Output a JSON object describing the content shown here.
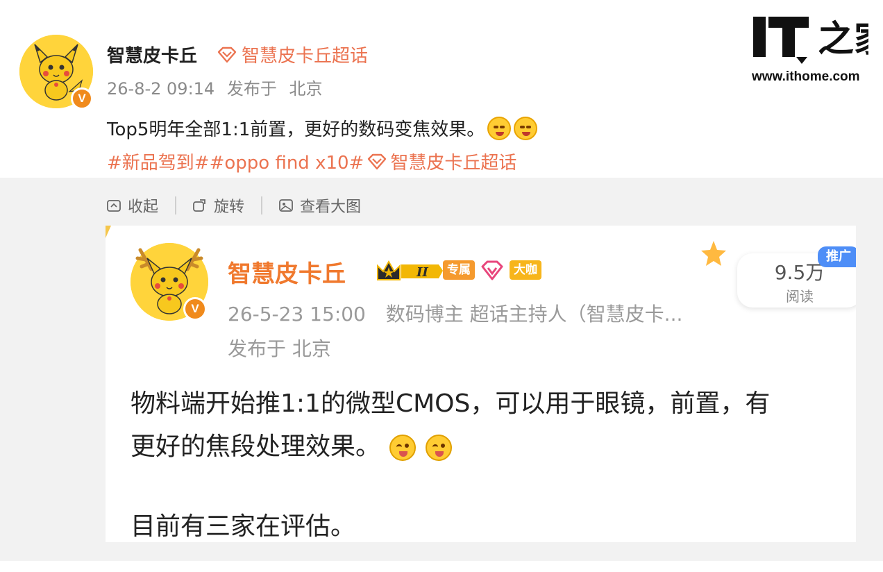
{
  "post": {
    "username": "智慧皮卡丘",
    "supertopic": "智慧皮卡丘超话",
    "time": "26-8-2 09:14",
    "location_prefix": "发布于",
    "location": "北京",
    "text": "Top5明年全部1:1前置，更好的数码变焦效果。",
    "tags_prefix": "#新品驾到##oppo find x10#",
    "tags_topic": "智慧皮卡丘超话"
  },
  "toolbar": {
    "collapse": "收起",
    "rotate": "旋转",
    "view_large": "查看大图"
  },
  "quoted": {
    "username": "智慧皮卡丘",
    "badge_level": "II",
    "badge_exclusive": "专属",
    "badge_bigshot": "大咖",
    "time": "26-5-23 15:00",
    "role": "数码博主 超话主持人（智慧皮卡...",
    "location_line": "发布于 北京",
    "reads": "9.5万",
    "reads_label": "阅读",
    "promo": "推广",
    "body_line1": "物料端开始推1:1的微型CMOS，可以用于眼镜，前置，有",
    "body_line2": "更好的焦段处理效果。",
    "body_line3": "目前有三家在评估。"
  },
  "watermark": {
    "url": "www.ithome.com"
  },
  "colors": {
    "accent": "#eb7350",
    "quoted_name": "#f0792e",
    "verified": "#f08a1c"
  }
}
